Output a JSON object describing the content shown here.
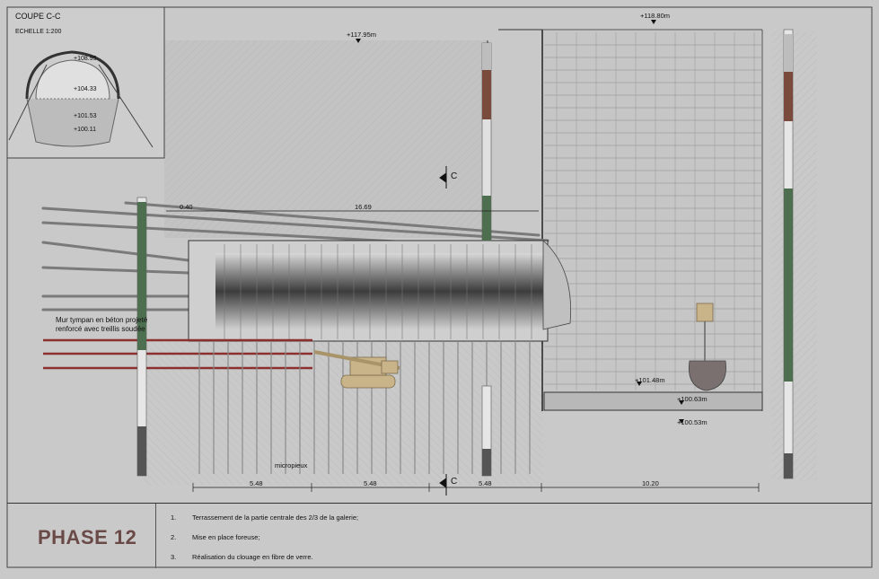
{
  "inset": {
    "title": "COUPE C-C",
    "scale": "ECHELLE 1:200",
    "levels": [
      "+108.95",
      "+104.33",
      "+101.53",
      "+100.11"
    ]
  },
  "levels": {
    "top_left": "+117.95m",
    "top_right": "+118.80m",
    "pit_bottom": "+101.48m",
    "level_2": "+100.63m",
    "level_3": "+100.53m"
  },
  "section_mark": "C",
  "dimensions": {
    "top_offset": "0.40",
    "top_length": "16.69",
    "bottom": [
      "5.48",
      "5.48",
      "5.48",
      "10.20"
    ]
  },
  "annotations": {
    "wall_note_line1": "Mur tympan en béton projeté",
    "wall_note_line2": "renforcé avec treillis soudée",
    "micropiles": "micropieux"
  },
  "phase": {
    "title": "PHASE 12",
    "steps": [
      {
        "num": "1.",
        "text": "Terrassement de la partie centrale des 2/3 de la galerie;"
      },
      {
        "num": "2.",
        "text": "Mise en place foreuse;"
      },
      {
        "num": "3.",
        "text": "Réalisation du clouage en fibre de verre."
      }
    ]
  },
  "colors": {
    "background": "#c9c9c9",
    "soil": "#bdbdbd",
    "green_layer": "#4e6e50",
    "brown_layer": "#7a4a3c",
    "anchor_red": "#8c2f2f",
    "anchor_grey": "#7a7a7a",
    "machine": "#c9b48a",
    "phase_title": "#6a4a47"
  }
}
